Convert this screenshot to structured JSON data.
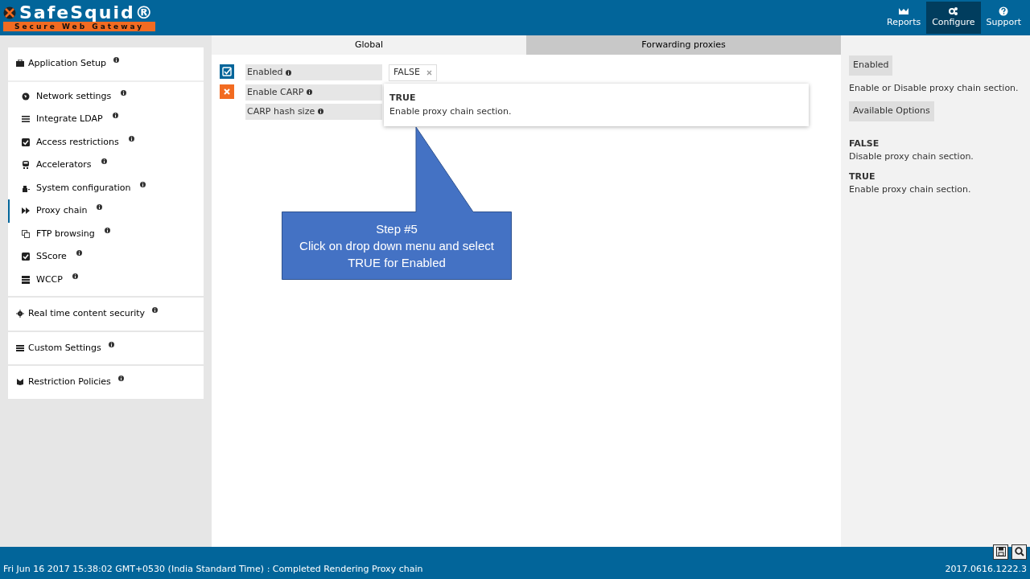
{
  "header": {
    "logo_title": "SafeSquid®",
    "logo_subtitle": "Secure Web Gateway",
    "nav": [
      {
        "label": "Reports",
        "selected": false
      },
      {
        "label": "Configure",
        "selected": true
      },
      {
        "label": "Support",
        "selected": false
      }
    ]
  },
  "sidebar": {
    "groups": [
      {
        "label": "Application Setup",
        "children": [
          {
            "label": "Network settings",
            "selected": false
          },
          {
            "label": "Integrate LDAP",
            "selected": false
          },
          {
            "label": "Access restrictions",
            "selected": false
          },
          {
            "label": "Accelerators",
            "selected": false
          },
          {
            "label": "System configuration",
            "selected": false
          },
          {
            "label": "Proxy chain",
            "selected": true
          },
          {
            "label": "FTP browsing",
            "selected": false
          },
          {
            "label": "SScore",
            "selected": false
          },
          {
            "label": "WCCP",
            "selected": false
          }
        ]
      },
      {
        "label": "Real time content security"
      },
      {
        "label": "Custom Settings"
      },
      {
        "label": "Restriction Policies"
      }
    ]
  },
  "tabs": [
    {
      "label": "Global",
      "selected": true
    },
    {
      "label": "Forwarding proxies",
      "selected": false
    }
  ],
  "fields": [
    {
      "label": "Enabled",
      "kind": "checked",
      "value": "FALSE"
    },
    {
      "label": "Enable CARP",
      "kind": "cross"
    },
    {
      "label": "CARP hash size",
      "kind": "plain"
    }
  ],
  "dropdown": {
    "options": [
      {
        "title": "TRUE",
        "description": "Enable proxy chain section."
      }
    ]
  },
  "help": {
    "title": "Enabled",
    "description": "Enable or Disable proxy chain section.",
    "options_heading": "Available Options",
    "options": [
      {
        "title": "FALSE",
        "description": "Disable proxy chain section."
      },
      {
        "title": "TRUE",
        "description": "Enable proxy chain section."
      }
    ]
  },
  "callout": {
    "lines": [
      "Step #5",
      "Click on drop down menu and select TRUE for Enabled"
    ]
  },
  "status_bar": {
    "message": "Fri Jun 16 2017 15:38:02 GMT+0530 (India Standard Time) : Completed Rendering Proxy chain",
    "version": "2017.0616.1222.3"
  }
}
